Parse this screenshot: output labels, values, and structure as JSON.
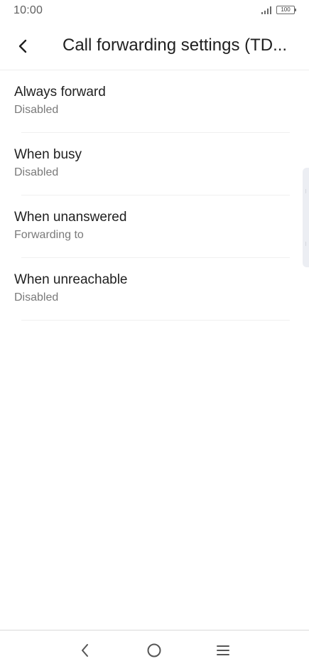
{
  "status_bar": {
    "time": "10:00",
    "battery": "100"
  },
  "header": {
    "title": "Call forwarding settings (TD...",
    "back_icon": "chevron-left-icon"
  },
  "items": [
    {
      "title": "Always forward",
      "subtitle": "Disabled"
    },
    {
      "title": "When busy",
      "subtitle": "Disabled"
    },
    {
      "title": "When unanswered",
      "subtitle": "Forwarding to"
    },
    {
      "title": "When unreachable",
      "subtitle": "Disabled"
    }
  ],
  "nav_bar": {
    "back_icon": "nav-back-icon",
    "home_icon": "nav-home-icon",
    "menu_icon": "nav-menu-icon"
  },
  "colors": {
    "title_text": "#1f1f1f",
    "subtitle_text": "#7a7a7a",
    "divider": "#f0f0f0",
    "background": "#ffffff"
  }
}
